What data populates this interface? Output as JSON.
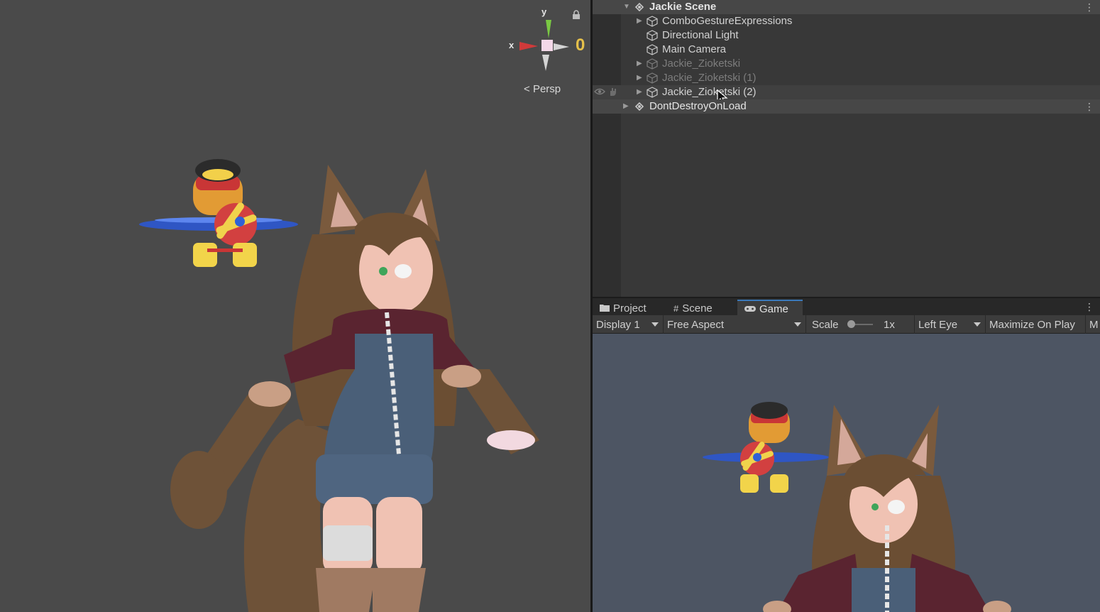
{
  "scene_view": {
    "gizmo": {
      "y_label": "y",
      "x_label": "x",
      "z_label": "0"
    },
    "projection_label": "Persp"
  },
  "hierarchy": {
    "scene_name": "Jackie Scene",
    "items": [
      {
        "label": "ComboGestureExpressions",
        "expandable": true,
        "dim": false
      },
      {
        "label": "Directional Light",
        "expandable": false,
        "dim": false
      },
      {
        "label": "Main Camera",
        "expandable": false,
        "dim": false
      },
      {
        "label": "Jackie_Zioketski",
        "expandable": true,
        "dim": true
      },
      {
        "label": "Jackie_Zioketski (1)",
        "expandable": true,
        "dim": true
      },
      {
        "label": "Jackie_Zioketski (2)",
        "expandable": true,
        "dim": false
      }
    ],
    "dont_destroy_label": "DontDestroyOnLoad"
  },
  "tabs": [
    {
      "label": "Project",
      "icon": "folder-icon"
    },
    {
      "label": "Scene",
      "icon": "grid-icon"
    },
    {
      "label": "Game",
      "icon": "gamepad-icon"
    }
  ],
  "game_toolbar": {
    "display": "Display 1",
    "aspect": "Free Aspect",
    "scale_label": "Scale",
    "scale_value": "1x",
    "eye": "Left Eye",
    "maximize": "Maximize On Play",
    "overflow": "M"
  },
  "colors": {
    "scene_bg": "#4a4a4a",
    "game_bg": "#4d5563",
    "accent": "#3a79bb",
    "gizmo_y": "#7ac943",
    "gizmo_x": "#d13a3a",
    "gizmo_z_label": "#e5c04a"
  }
}
